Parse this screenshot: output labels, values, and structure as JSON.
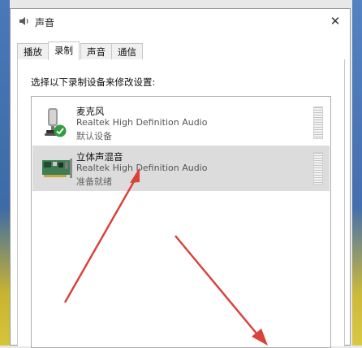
{
  "window": {
    "title": "声音",
    "close_glyph": "✕"
  },
  "tabs": [
    {
      "label": "播放",
      "active": false
    },
    {
      "label": "录制",
      "active": true
    },
    {
      "label": "声音",
      "active": false
    },
    {
      "label": "通信",
      "active": false
    }
  ],
  "panel": {
    "instruction": "选择以下录制设备来修改设置:"
  },
  "devices": [
    {
      "name": "麦克风",
      "description": "Realtek High Definition Audio",
      "status": "默认设备",
      "icon": "microphone-icon",
      "default_badge": "check-icon",
      "selected": false
    },
    {
      "name": "立体声混音",
      "description": "Realtek High Definition Audio",
      "status": "准备就绪",
      "icon": "sound-card-icon",
      "selected": true
    }
  ],
  "colors": {
    "accent_check": "#2e9e3e",
    "selection_bg": "#dcdcdc",
    "annotation_arrow": "#d9433a"
  }
}
